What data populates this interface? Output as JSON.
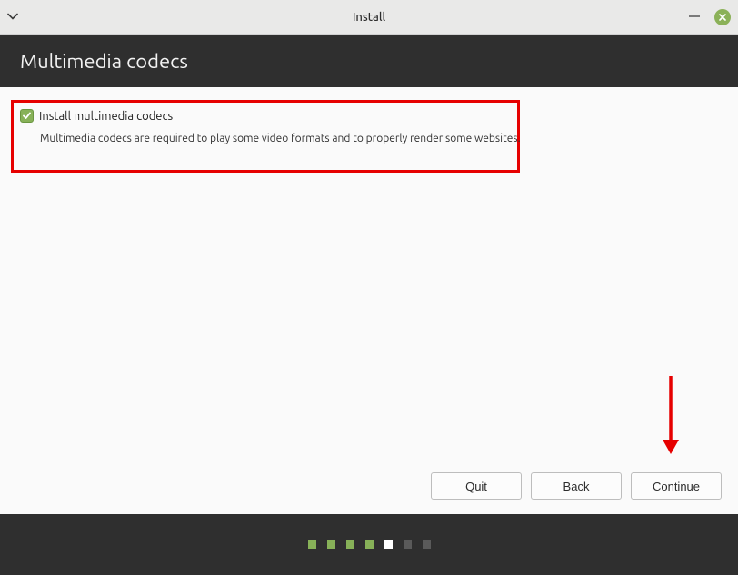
{
  "window": {
    "title": "Install"
  },
  "header": {
    "heading": "Multimedia codecs"
  },
  "option": {
    "label": "Install multimedia codecs",
    "description": "Multimedia codecs are required to play some video formats and to properly render some websites.",
    "checked": true
  },
  "buttons": {
    "quit": "Quit",
    "back": "Back",
    "continue": "Continue"
  },
  "progress": {
    "total": 7,
    "current": 5
  }
}
